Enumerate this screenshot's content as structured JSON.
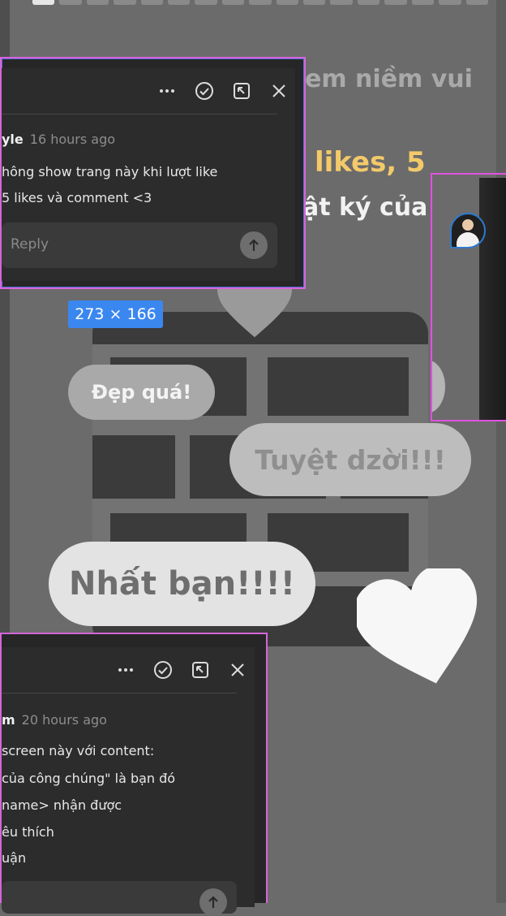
{
  "story": {
    "line1": "em niềm vui",
    "line2": "likes, 5",
    "line3": "ật ký của",
    "progress": {
      "segments": 17,
      "active_index": 0
    }
  },
  "bubbles": {
    "bubble1": "Đẹp quá!",
    "bubble2": "Tuyệt dzời!!!",
    "bubble3": "Nhất bạn!!!!"
  },
  "dimension_badge": "273 × 166",
  "comment_top": {
    "author": "yle",
    "time": "16 hours ago",
    "lines": [
      "hông show trang này khi lượt like",
      "5 likes và comment <3"
    ],
    "reply_placeholder": "Reply"
  },
  "comment_bottom": {
    "author": "m",
    "time": "20 hours ago",
    "lines": [
      "screen này với content:",
      "của công chúng\" là bạn đó",
      "name> nhận được",
      "êu thích",
      "uận"
    ]
  },
  "icons": [
    "more-icon",
    "resolve-check-icon",
    "open-in-icon",
    "close-icon",
    "send-arrow-icon"
  ],
  "colors": {
    "highlight_yellow": "#f3c96a",
    "selection_pink": "#d565d9",
    "badge_blue": "#3b87f0",
    "avatar_ring": "#2d7ad1"
  }
}
